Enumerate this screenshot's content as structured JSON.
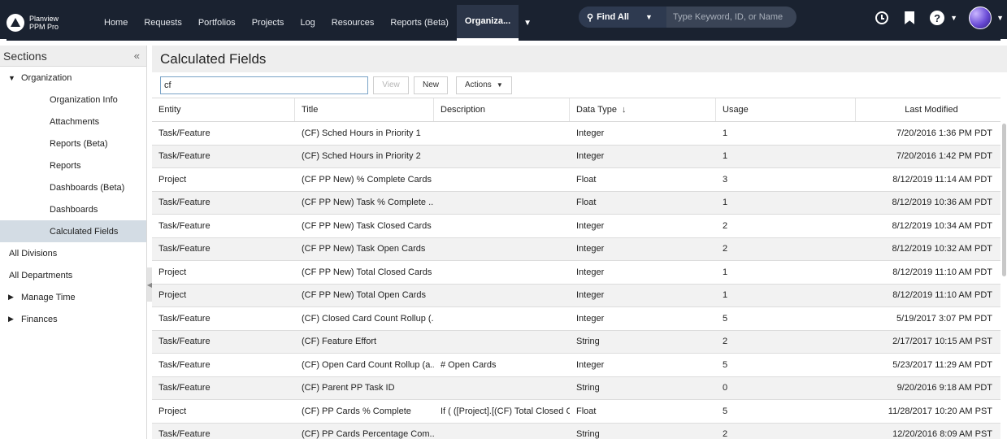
{
  "brand": {
    "line1": "Planview",
    "line2": "PPM Pro"
  },
  "nav": [
    {
      "label": "Home"
    },
    {
      "label": "Requests"
    },
    {
      "label": "Portfolios"
    },
    {
      "label": "Projects"
    },
    {
      "label": "Log"
    },
    {
      "label": "Resources"
    },
    {
      "label": "Reports (Beta)"
    },
    {
      "label": "Organiza..."
    }
  ],
  "search": {
    "scope": "Find All",
    "placeholder": "Type Keyword, ID, or Name"
  },
  "sidebar": {
    "title": "Sections",
    "items": [
      {
        "label": "Organization",
        "level": "lvl0",
        "expanded": true
      },
      {
        "label": "Organization Info",
        "level": "lvl1"
      },
      {
        "label": "Attachments",
        "level": "lvl1"
      },
      {
        "label": "Reports (Beta)",
        "level": "lvl1"
      },
      {
        "label": "Reports",
        "level": "lvl1"
      },
      {
        "label": "Dashboards (Beta)",
        "level": "lvl1"
      },
      {
        "label": "Dashboards",
        "level": "lvl1"
      },
      {
        "label": "Calculated Fields",
        "level": "lvl1",
        "selected": true
      },
      {
        "label": "All Divisions",
        "level": "plain"
      },
      {
        "label": "All Departments",
        "level": "plain"
      },
      {
        "label": "Manage Time",
        "level": "lvl0",
        "expanded": false
      },
      {
        "label": "Finances",
        "level": "lvl0",
        "expanded": false
      }
    ]
  },
  "page": {
    "title": "Calculated Fields"
  },
  "toolbar": {
    "filter_value": "cf",
    "view_label": "View",
    "new_label": "New",
    "actions_label": "Actions"
  },
  "table": {
    "columns": [
      "Entity",
      "Title",
      "Description",
      "Data Type",
      "Usage",
      "Last Modified"
    ],
    "sorted_column": "Data Type",
    "rows": [
      [
        "Task/Feature",
        "(CF) Sched Hours in Priority 1",
        "",
        "Integer",
        "1",
        "7/20/2016 1:36 PM PDT"
      ],
      [
        "Task/Feature",
        "(CF) Sched Hours in Priority 2",
        "",
        "Integer",
        "1",
        "7/20/2016 1:42 PM PDT"
      ],
      [
        "Project",
        "(CF PP New) % Complete Cards",
        "",
        "Float",
        "3",
        "8/12/2019 11:14 AM PDT"
      ],
      [
        "Task/Feature",
        "(CF PP New) Task % Complete ...",
        "",
        "Float",
        "1",
        "8/12/2019 10:36 AM PDT"
      ],
      [
        "Task/Feature",
        "(CF PP New) Task Closed Cards",
        "",
        "Integer",
        "2",
        "8/12/2019 10:34 AM PDT"
      ],
      [
        "Task/Feature",
        "(CF PP New) Task Open Cards",
        "",
        "Integer",
        "2",
        "8/12/2019 10:32 AM PDT"
      ],
      [
        "Project",
        "(CF PP New) Total Closed Cards",
        "",
        "Integer",
        "1",
        "8/12/2019 11:10 AM PDT"
      ],
      [
        "Project",
        "(CF PP New) Total Open Cards",
        "",
        "Integer",
        "1",
        "8/12/2019 11:10 AM PDT"
      ],
      [
        "Task/Feature",
        "(CF) Closed Card Count Rollup (...",
        "",
        "Integer",
        "5",
        "5/19/2017 3:07 PM PDT"
      ],
      [
        "Task/Feature",
        "(CF) Feature Effort",
        "",
        "String",
        "2",
        "2/17/2017 10:15 AM PST"
      ],
      [
        "Task/Feature",
        "(CF) Open Card Count Rollup (a...",
        "# Open Cards",
        "Integer",
        "5",
        "5/23/2017 11:29 AM PDT"
      ],
      [
        "Task/Feature",
        "(CF) Parent PP Task ID",
        "",
        "String",
        "0",
        "9/20/2016 9:18 AM PDT"
      ],
      [
        "Project",
        "(CF) PP Cards % Complete",
        "If ( ([Project].[(CF) Total Closed C...",
        "Float",
        "5",
        "11/28/2017 10:20 AM PST"
      ],
      [
        "Task/Feature",
        "(CF) PP Cards Percentage Com...",
        "",
        "String",
        "2",
        "12/20/2016 8:09 AM PST"
      ]
    ]
  }
}
